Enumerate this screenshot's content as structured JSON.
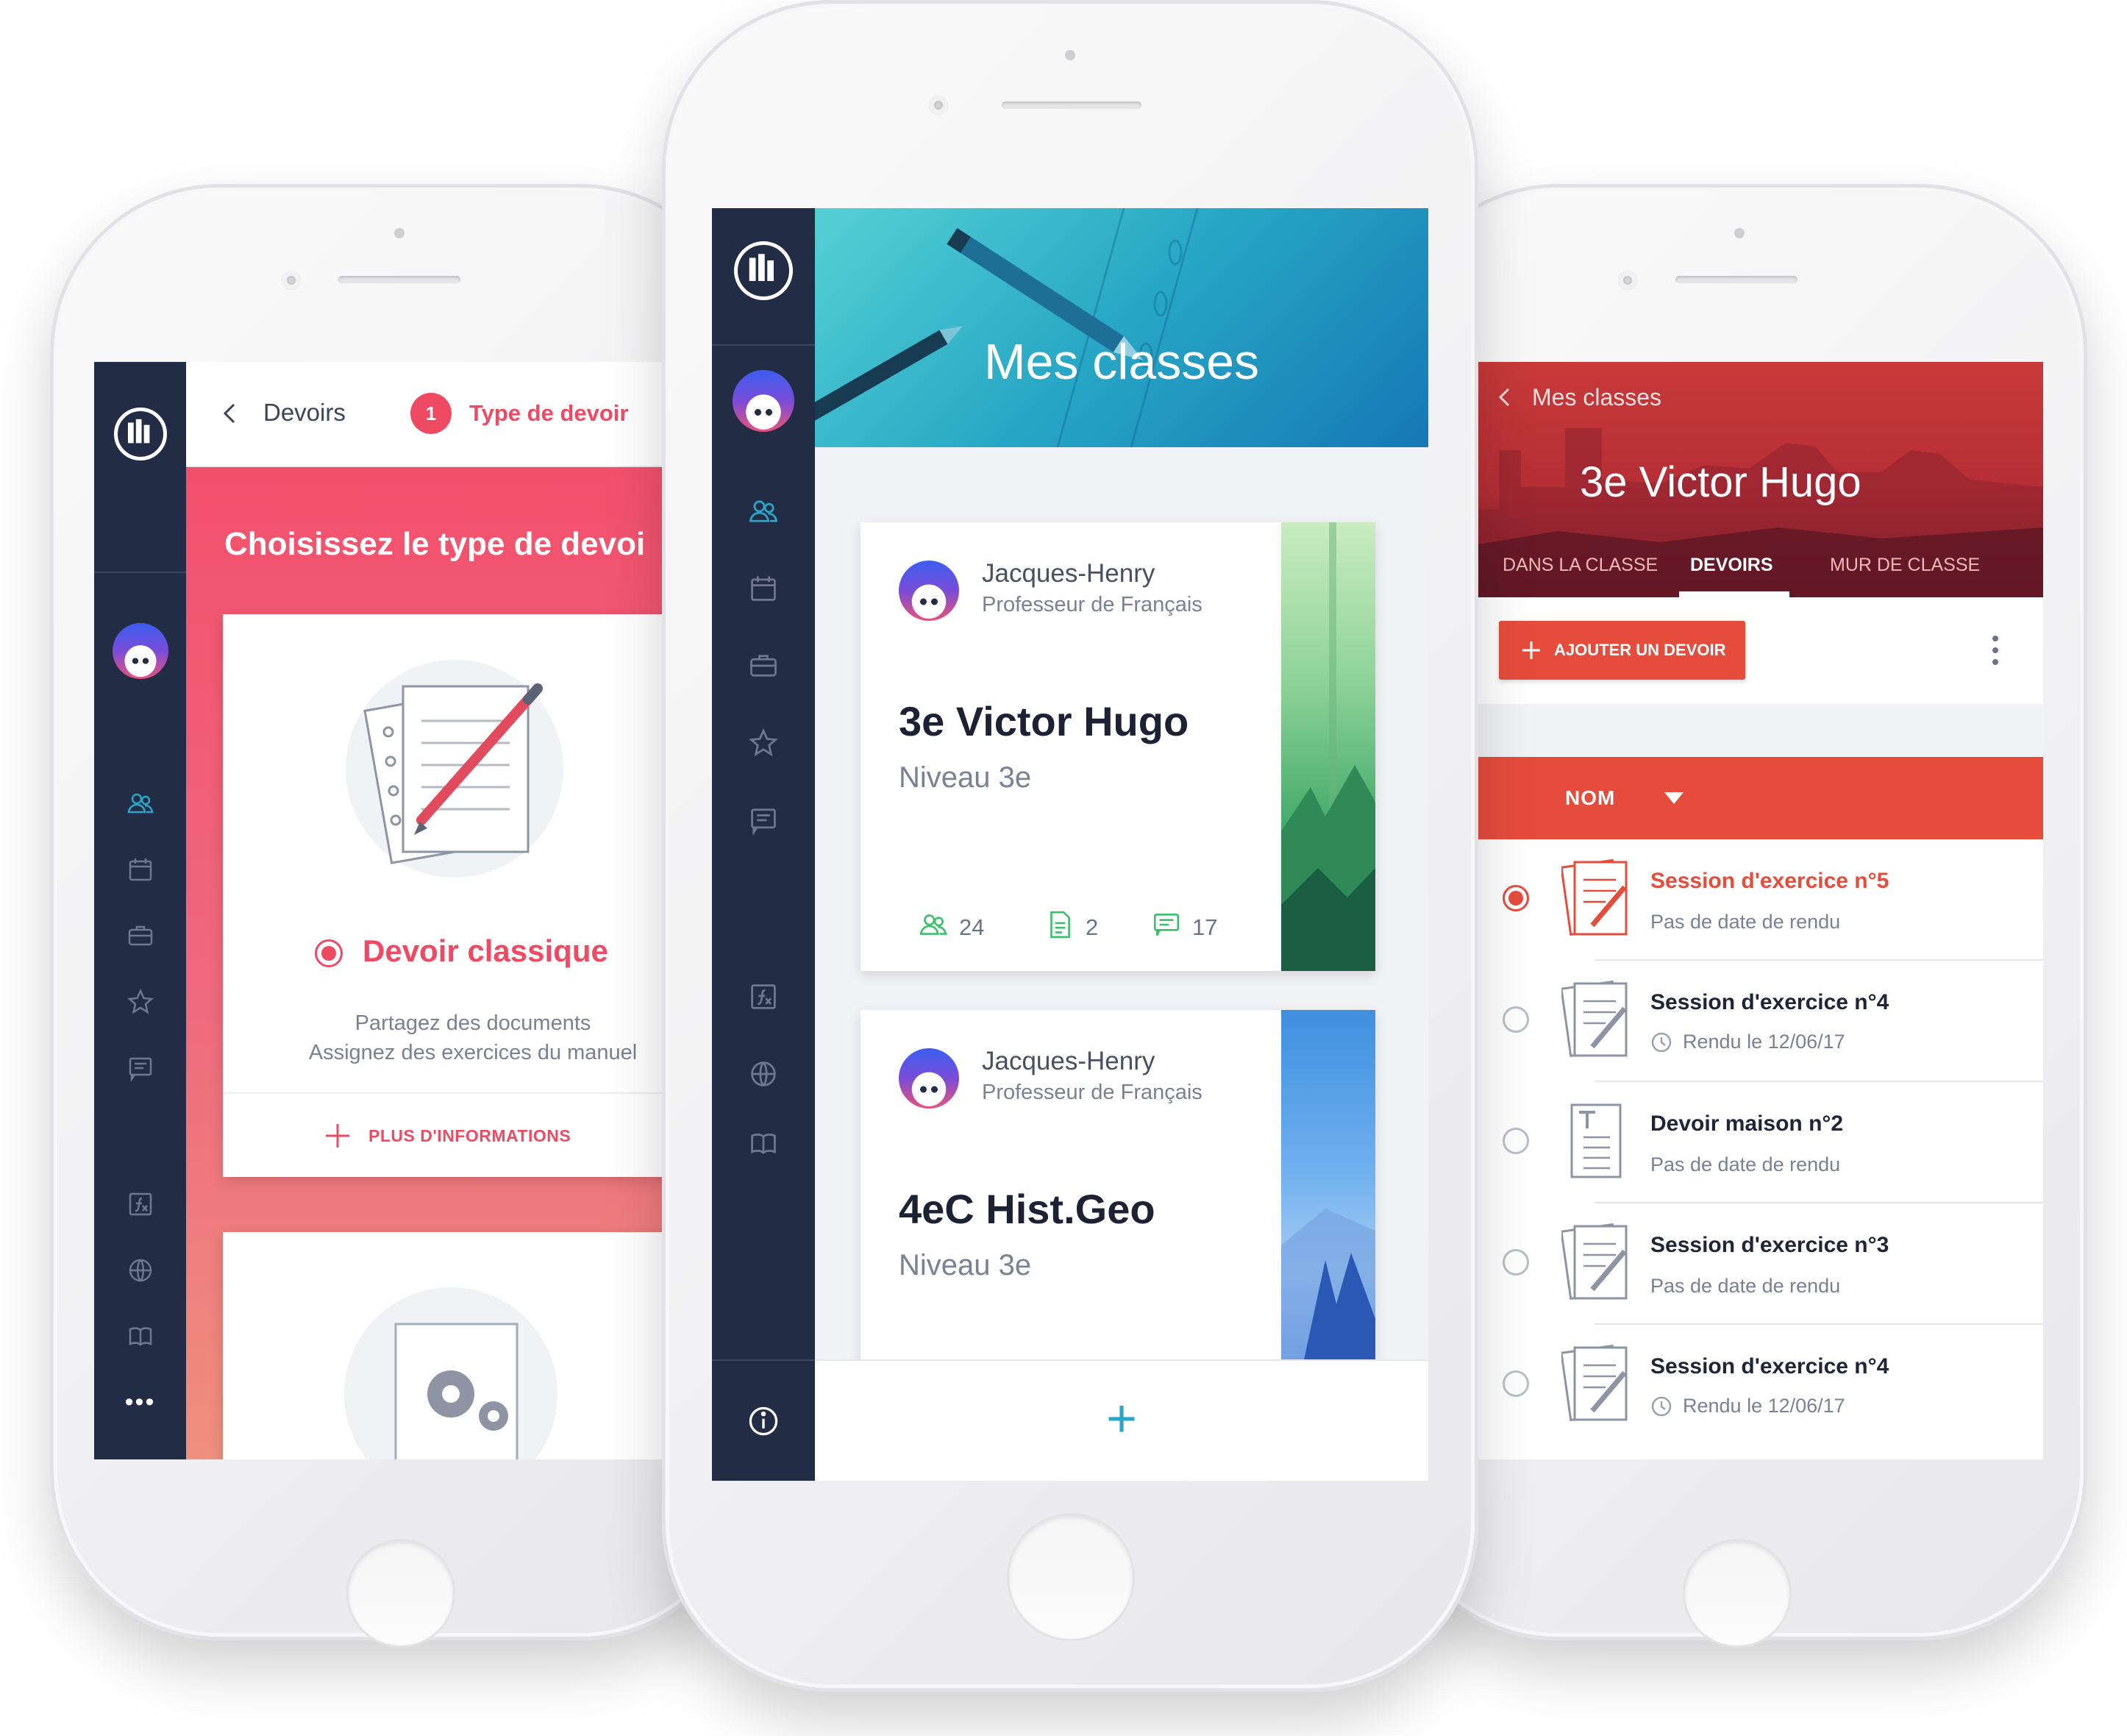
{
  "left_screen": {
    "back_label": "Devoirs",
    "step_number": "1",
    "step_label": "Type de devoir",
    "hero_title": "Choisissez le type de devoi",
    "option_title": "Devoir classique",
    "option_desc_line1": "Partagez des documents",
    "option_desc_line2": "Assignez des exercices du manuel",
    "more_info_label": "PLUS D'INFORMATIONS",
    "more_icon": "•••"
  },
  "center_screen": {
    "title": "Mes classes",
    "classes": [
      {
        "teacher_name": "Jacques-Henry",
        "teacher_role": "Professeur de Français",
        "class_name": "3e Victor Hugo",
        "level": "Niveau 3e",
        "students": "24",
        "documents": "2",
        "messages": "17"
      },
      {
        "teacher_name": "Jacques-Henry",
        "teacher_role": "Professeur de Français",
        "class_name": "4eC Hist.Geo",
        "level": "Niveau 3e"
      }
    ],
    "add_label": "+"
  },
  "right_screen": {
    "back_label": "Mes classes",
    "title": "3e Victor Hugo",
    "tabs": [
      "DANS LA CLASSE",
      "DEVOIRS",
      "MUR DE CLASSE"
    ],
    "add_button": "AJOUTER UN DEVOIR",
    "sort_label": "NOM",
    "homeworks": [
      {
        "title": "Session d'exercice n°5",
        "subtitle": "Pas de date de rendu"
      },
      {
        "title": "Session d'exercice n°4",
        "subtitle": "Rendu le 12/06/17"
      },
      {
        "title": "Devoir maison n°2",
        "subtitle": "Pas de date de rendu"
      },
      {
        "title": "Session d'exercice n°3",
        "subtitle": "Pas de date de rendu"
      },
      {
        "title": "Session d'exercice n°4",
        "subtitle": "Rendu le 12/06/17"
      }
    ]
  },
  "colors": {
    "sidebar": "#232c45",
    "accent_red": "#ef4a64",
    "accent_teal": "#2aa6c9",
    "sort_bar": "#e64c3c",
    "stat_green": "#3bbf6b"
  }
}
